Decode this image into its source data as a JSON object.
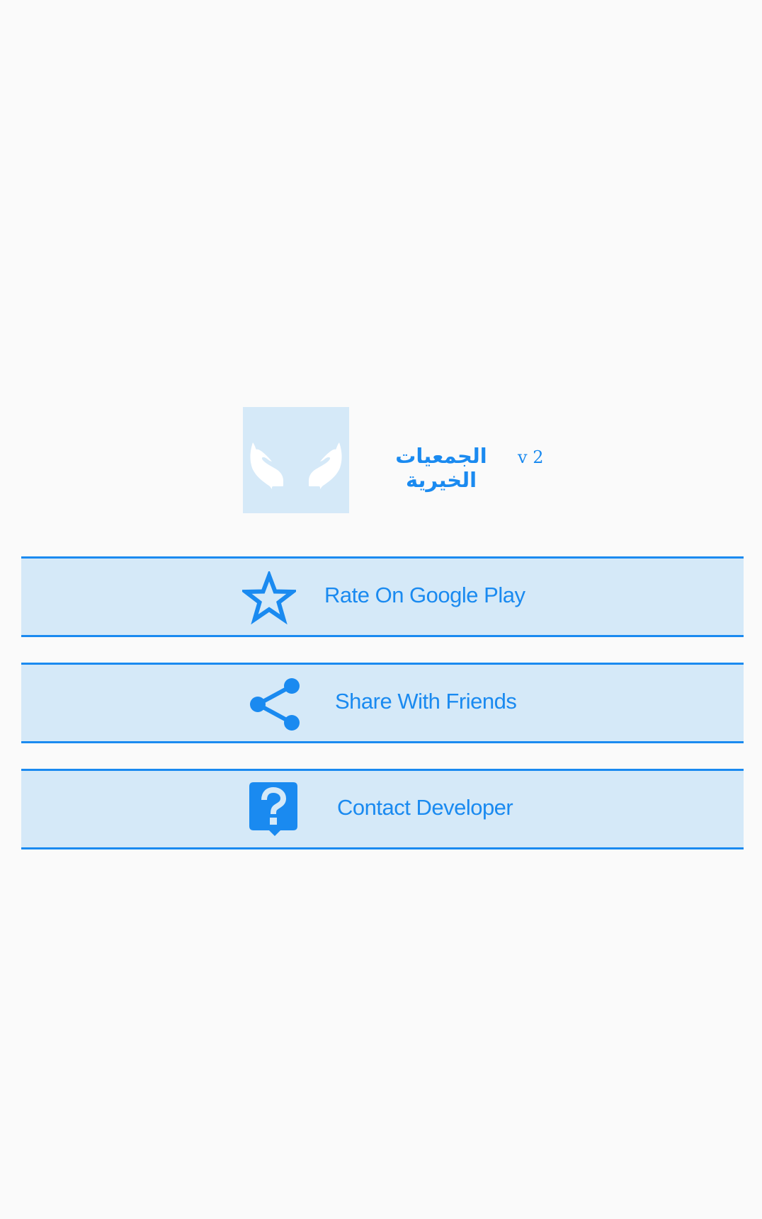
{
  "app": {
    "name": "الجمعيات الخيرية",
    "version": "v 2",
    "logo_icon": "open-hands-icon"
  },
  "actions": [
    {
      "label": "Rate On Google Play",
      "icon": "star-outline-icon"
    },
    {
      "label": "Share With Friends",
      "icon": "share-icon"
    },
    {
      "label": "Contact Developer",
      "icon": "help-question-icon"
    }
  ],
  "colors": {
    "background": "#fafafa",
    "accent": "#1a8af0",
    "panel": "#d5e9f8",
    "logo_fg": "#ffffff"
  }
}
